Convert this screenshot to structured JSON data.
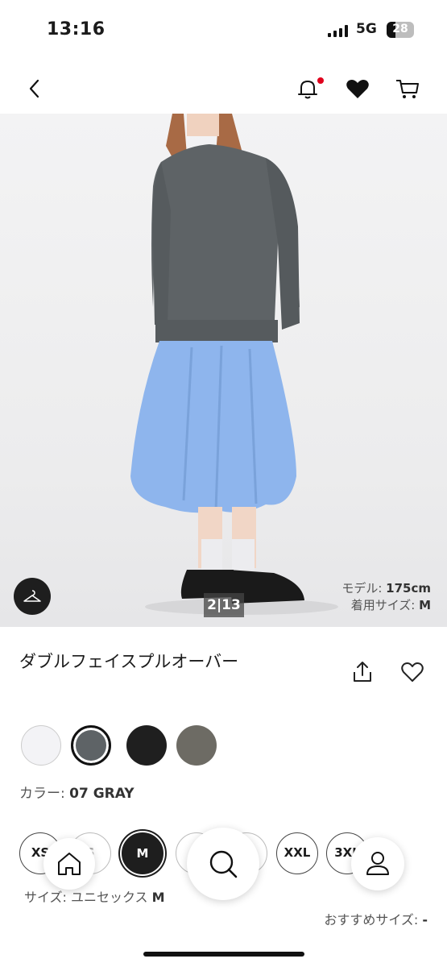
{
  "status_bar": {
    "time": "13:16",
    "network": "5G",
    "battery": "28"
  },
  "nav": {
    "back_icon": "chevron-left-icon",
    "bell_icon": "bell-icon",
    "heart_icon": "heart-filled-icon",
    "cart_icon": "cart-icon",
    "notification_dot_color": "#e0001c"
  },
  "gallery": {
    "counter": "2|13",
    "model_height_label": "モデル: ",
    "model_height_value": "175cm",
    "model_size_label": "着用サイズ: ",
    "model_size_value": "M"
  },
  "product": {
    "title": "ダブルフェイスプルオーバー",
    "color_label": "カラー: ",
    "color_value": "07 GRAY",
    "swatches": [
      {
        "name": "white",
        "color": "#f3f3f6"
      },
      {
        "name": "gray",
        "color": "#5e6366",
        "selected": true
      },
      {
        "name": "black",
        "color": "#1f1f1f"
      },
      {
        "name": "olive",
        "color": "#6d6b64"
      }
    ],
    "sizes": [
      "XS",
      "S",
      "M",
      "L",
      "XL",
      "XXL",
      "3XL"
    ],
    "selected_size": "M",
    "size_label": "サイズ: ユニセックス ",
    "size_value": "M",
    "recommended_label": "おすすめサイズ: ",
    "recommended_value": "-"
  },
  "bottom_bar": {
    "home_icon": "home-icon",
    "search_icon": "search-icon",
    "account_icon": "account-icon"
  }
}
